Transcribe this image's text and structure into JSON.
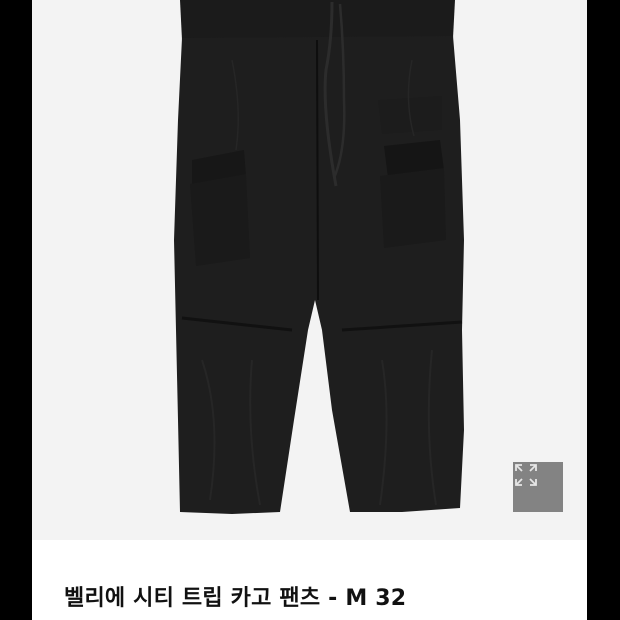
{
  "product": {
    "title": "벨리에 시티 트립 카고 팬츠 - M 32",
    "image_alt": "black cargo pants product photo"
  },
  "gallery": {
    "expand_icon": "expand-icon"
  },
  "colors": {
    "frame_background": "#000000",
    "photo_background": "#f3f3f3",
    "pants": "#1d1d1d",
    "expand_button_bg": "#6e6e6e",
    "title_text": "#111111"
  }
}
